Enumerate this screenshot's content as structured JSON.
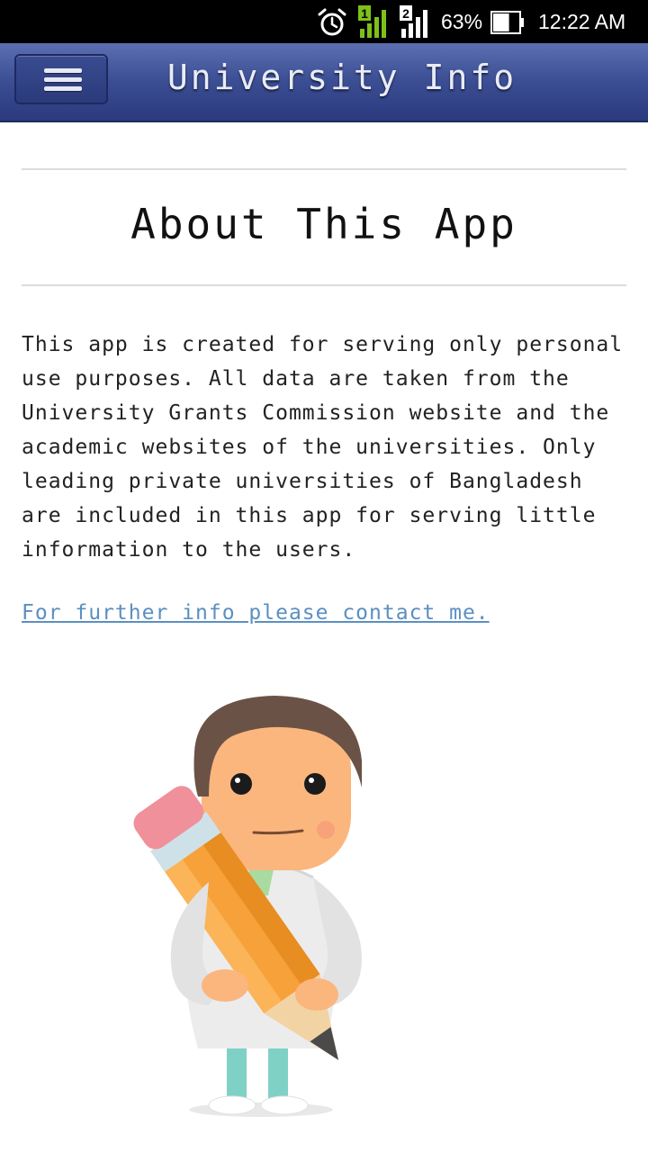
{
  "status_bar": {
    "sim1_label": "1",
    "sim2_label": "2",
    "battery_percent": "63%",
    "battery_level": 0.63,
    "time": "12:22 AM"
  },
  "header": {
    "title": "University Info"
  },
  "content": {
    "title": "About This App",
    "description": "This app is created for serving only personal\nuse purposes. All data are taken from the\nUniversity Grants Commission website and the\nacademic websites of the universities. Only\nleading private universities of Bangladesh\nare included in this app for serving little\ninformation to the users.",
    "contact_link": "For further info please contact me."
  },
  "colors": {
    "header": "#3b4d93",
    "link": "#5b8fc2",
    "signal_active": "#7cc11a"
  }
}
